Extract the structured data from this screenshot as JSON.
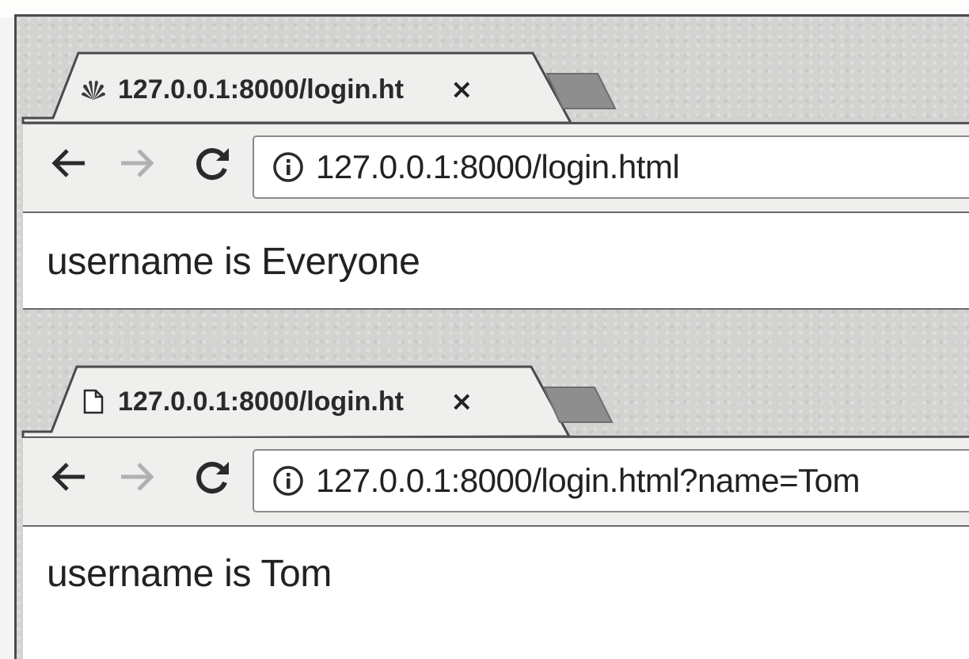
{
  "windows": [
    {
      "tab": {
        "title": "127.0.0.1:8000/login.ht",
        "favicon": "huawei-logo-icon",
        "close": "×"
      },
      "address_bar": {
        "url": "127.0.0.1:8000/login.html"
      },
      "page": {
        "text": "username is Everyone"
      }
    },
    {
      "tab": {
        "title": "127.0.0.1:8000/login.ht",
        "favicon": "page-icon",
        "close": "×"
      },
      "address_bar": {
        "url": "127.0.0.1:8000/login.html?name=Tom"
      },
      "page": {
        "text": "username is Tom"
      }
    }
  ],
  "icons": {
    "back": "back-arrow-icon",
    "forward": "forward-arrow-icon",
    "reload": "reload-icon",
    "info": "info-icon"
  },
  "colors": {
    "chrome_gray": "#d3d3d1",
    "toolbar": "#efefed",
    "page_bg": "#ffffff",
    "new_tab": "#8e8e8e",
    "forward_disabled": "#b0b0b0"
  }
}
